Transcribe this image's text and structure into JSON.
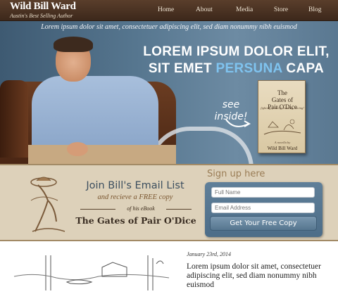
{
  "header": {
    "logo_title": "Wild Bill Ward",
    "logo_subtitle": "Austin's Best Selling Author",
    "nav": [
      "Home",
      "About",
      "Media",
      "Store",
      "Blog"
    ]
  },
  "hero": {
    "tagline": "Lorem ipsum dolor sit amet, consectetuer adipiscing elit, sed diam nonummy nibh euismod",
    "headline_line1": "LOREM IPSUM DOLOR ELIT,",
    "headline_line2_a": "SIT EMET ",
    "headline_line2_highlight": "PERSUNA",
    "headline_line2_b": " CAPA",
    "see_inside_1": "see",
    "see_inside_2": "inside!",
    "book": {
      "title_line1": "The",
      "title_line2": "Gates of",
      "title_line3": "Pair O'Dice",
      "tagline": "fighting, feuding, rustling, racing!",
      "subtitle": "A novella by",
      "author": "Wild Bill Ward"
    }
  },
  "signup": {
    "heading": "Sign up here",
    "join": "Join Bill's Email List",
    "free": "and recieve a FREE copy",
    "ebook": "of his eBook",
    "book_title": "The Gates of Pair O'Dice",
    "full_name_placeholder": "Full Name",
    "email_placeholder": "Email Address",
    "cta": "Get Your Free Copy"
  },
  "post": {
    "date": "January 23rd, 2014",
    "body": "Lorem ipsum dolor sit amet, consectetuer adipiscing elit, sed diam nonummy nibh euismod"
  },
  "colors": {
    "header_brown": "#4a3121",
    "hero_blue": "#56768f",
    "accent_blue": "#7fc3ef",
    "signup_tan": "#ddd1ba"
  }
}
